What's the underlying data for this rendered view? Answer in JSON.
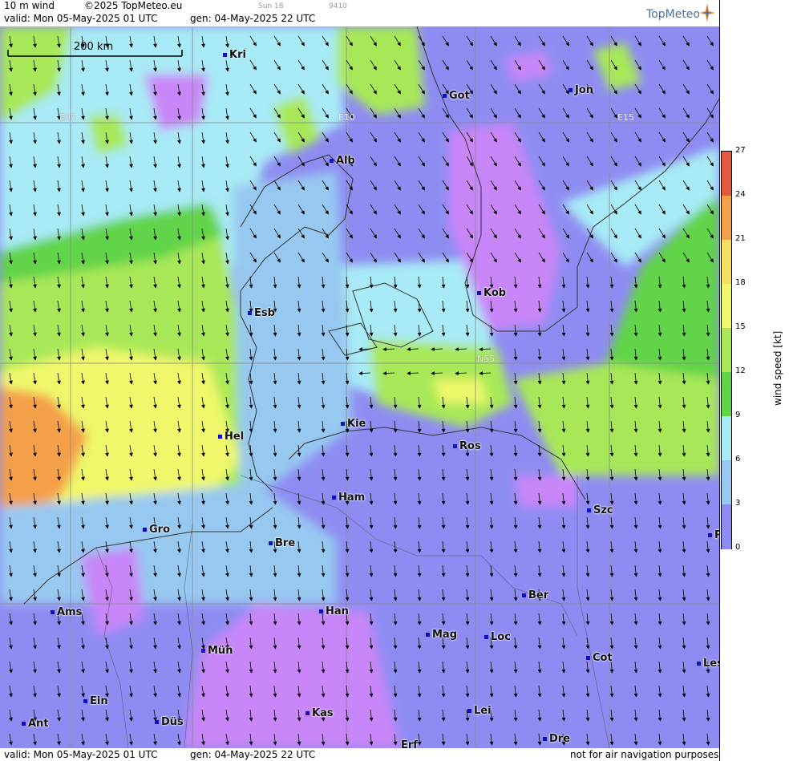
{
  "header": {
    "product": "10 m wind",
    "copyright": "©2025 TopMeteo.eu",
    "sun": "Sun 18",
    "code": "9410",
    "valid": "valid:  Mon  05-May-2025  01 UTC",
    "gen": "gen: 04-May-2025 22 UTC",
    "brand": "TopMeteo"
  },
  "footer": {
    "valid": "valid:  Mon  05-May-2025  01 UTC",
    "gen": "gen: 04-May-2025 22 UTC",
    "note": "not for air navigation purposes"
  },
  "scale_bar": {
    "label": "200 km"
  },
  "grid_labels": [
    "E05",
    "E10",
    "E15",
    "N55"
  ],
  "cities": [
    {
      "name": "Kri"
    },
    {
      "name": "Got"
    },
    {
      "name": "Jon"
    },
    {
      "name": "Alb"
    },
    {
      "name": "Kob"
    },
    {
      "name": "Esb"
    },
    {
      "name": "Kie"
    },
    {
      "name": "Hel"
    },
    {
      "name": "Ros"
    },
    {
      "name": "Ham"
    },
    {
      "name": "Szc"
    },
    {
      "name": "Gro"
    },
    {
      "name": "Bre"
    },
    {
      "name": "P"
    },
    {
      "name": "Ber"
    },
    {
      "name": "Ams"
    },
    {
      "name": "Han"
    },
    {
      "name": "Mag"
    },
    {
      "name": "Loc"
    },
    {
      "name": "Mün"
    },
    {
      "name": "Cot"
    },
    {
      "name": "Les"
    },
    {
      "name": "Ein"
    },
    {
      "name": "Kas"
    },
    {
      "name": "Lei"
    },
    {
      "name": "Ant"
    },
    {
      "name": "Düs"
    },
    {
      "name": "Dre"
    },
    {
      "name": "Erf"
    }
  ],
  "colorbar": {
    "title": "wind speed [kt]",
    "ticks": [
      "27",
      "24",
      "21",
      "18",
      "15",
      "12",
      "9",
      "6",
      "3",
      "0"
    ],
    "colors": [
      "#e15a40",
      "#f4a04a",
      "#f7e060",
      "#eef86a",
      "#a8e858",
      "#62d44a",
      "#a8eaf6",
      "#96c8f0",
      "#8e8cf2",
      "#c886f8"
    ]
  }
}
